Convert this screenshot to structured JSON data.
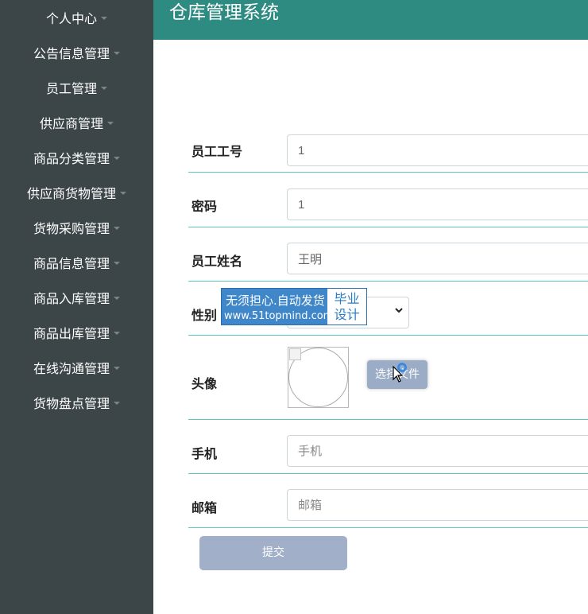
{
  "header": {
    "title": "仓库管理系统"
  },
  "sidebar": {
    "items": [
      {
        "label": "个人中心"
      },
      {
        "label": "公告信息管理"
      },
      {
        "label": "员工管理"
      },
      {
        "label": "供应商管理"
      },
      {
        "label": "商品分类管理"
      },
      {
        "label": "供应商货物管理"
      },
      {
        "label": "货物采购管理"
      },
      {
        "label": "商品信息管理"
      },
      {
        "label": "商品入库管理"
      },
      {
        "label": "商品出库管理"
      },
      {
        "label": "在线沟通管理"
      },
      {
        "label": "货物盘点管理"
      }
    ]
  },
  "form": {
    "employee_no": {
      "label": "员工工号",
      "value": "1"
    },
    "password": {
      "label": "密码",
      "value": "1"
    },
    "name": {
      "label": "员工姓名",
      "value": "王明"
    },
    "gender": {
      "label": "性别"
    },
    "avatar": {
      "label": "头像",
      "button": "选择文件"
    },
    "phone": {
      "label": "手机",
      "placeholder": "手机"
    },
    "email": {
      "label": "邮箱",
      "placeholder": "邮箱"
    },
    "submit": "提交"
  },
  "badge": {
    "line1": "无须担心.自动发货",
    "line2": "www.51topmind.com",
    "right1": "毕业",
    "right2": "设计"
  },
  "colors": {
    "sidebar": "#3c4649",
    "header": "#2e8b82",
    "row_border": "#5ec7c1",
    "button": "#9badc6"
  }
}
